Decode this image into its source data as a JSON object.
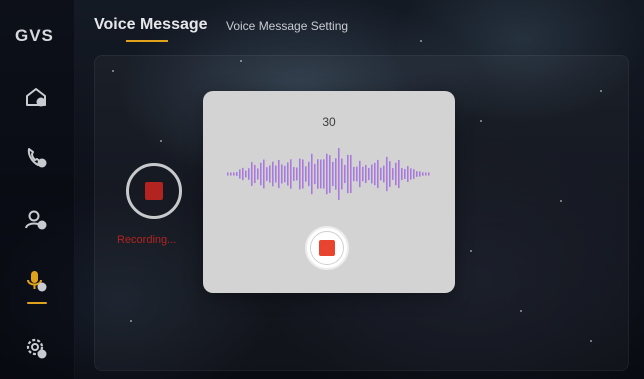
{
  "app": {
    "logo": "GVS"
  },
  "header": {
    "title": "Voice Message",
    "tab_setting": "Voice Message Setting"
  },
  "sidebar": {
    "items": [
      {
        "icon": "home-icon",
        "active": false
      },
      {
        "icon": "phone-icon",
        "active": false
      },
      {
        "icon": "contacts-icon",
        "active": false
      },
      {
        "icon": "voice-message-icon",
        "active": true
      },
      {
        "icon": "settings-icon",
        "active": false
      }
    ]
  },
  "recorder": {
    "status": "Recording...",
    "status_color": "#b3231f"
  },
  "modal": {
    "countdown": "30",
    "stop_color": "#e8442f"
  },
  "colors": {
    "accent": "#e0a11b",
    "modal_bg": "#d3d3d3"
  }
}
